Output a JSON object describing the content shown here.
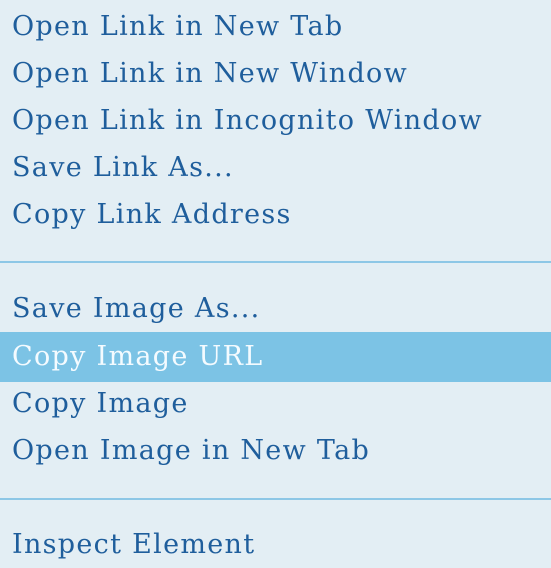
{
  "context_menu": {
    "link_group": [
      {
        "label": "Open Link in New Tab"
      },
      {
        "label": "Open Link in New Window"
      },
      {
        "label": "Open Link in Incognito Window"
      },
      {
        "label": "Save Link As..."
      },
      {
        "label": "Copy Link Address"
      }
    ],
    "image_group": [
      {
        "label": "Save Image As..."
      },
      {
        "label": "Copy Image URL",
        "highlighted": true
      },
      {
        "label": "Copy Image"
      },
      {
        "label": "Open Image in New Tab"
      }
    ],
    "dev_group": [
      {
        "label": "Inspect Element"
      }
    ],
    "colors": {
      "background": "#e3eef4",
      "text": "#1f5e9c",
      "highlight_background": "#7cc3e5",
      "highlight_text": "#f4fbff",
      "separator": "#8dc7e6"
    }
  }
}
